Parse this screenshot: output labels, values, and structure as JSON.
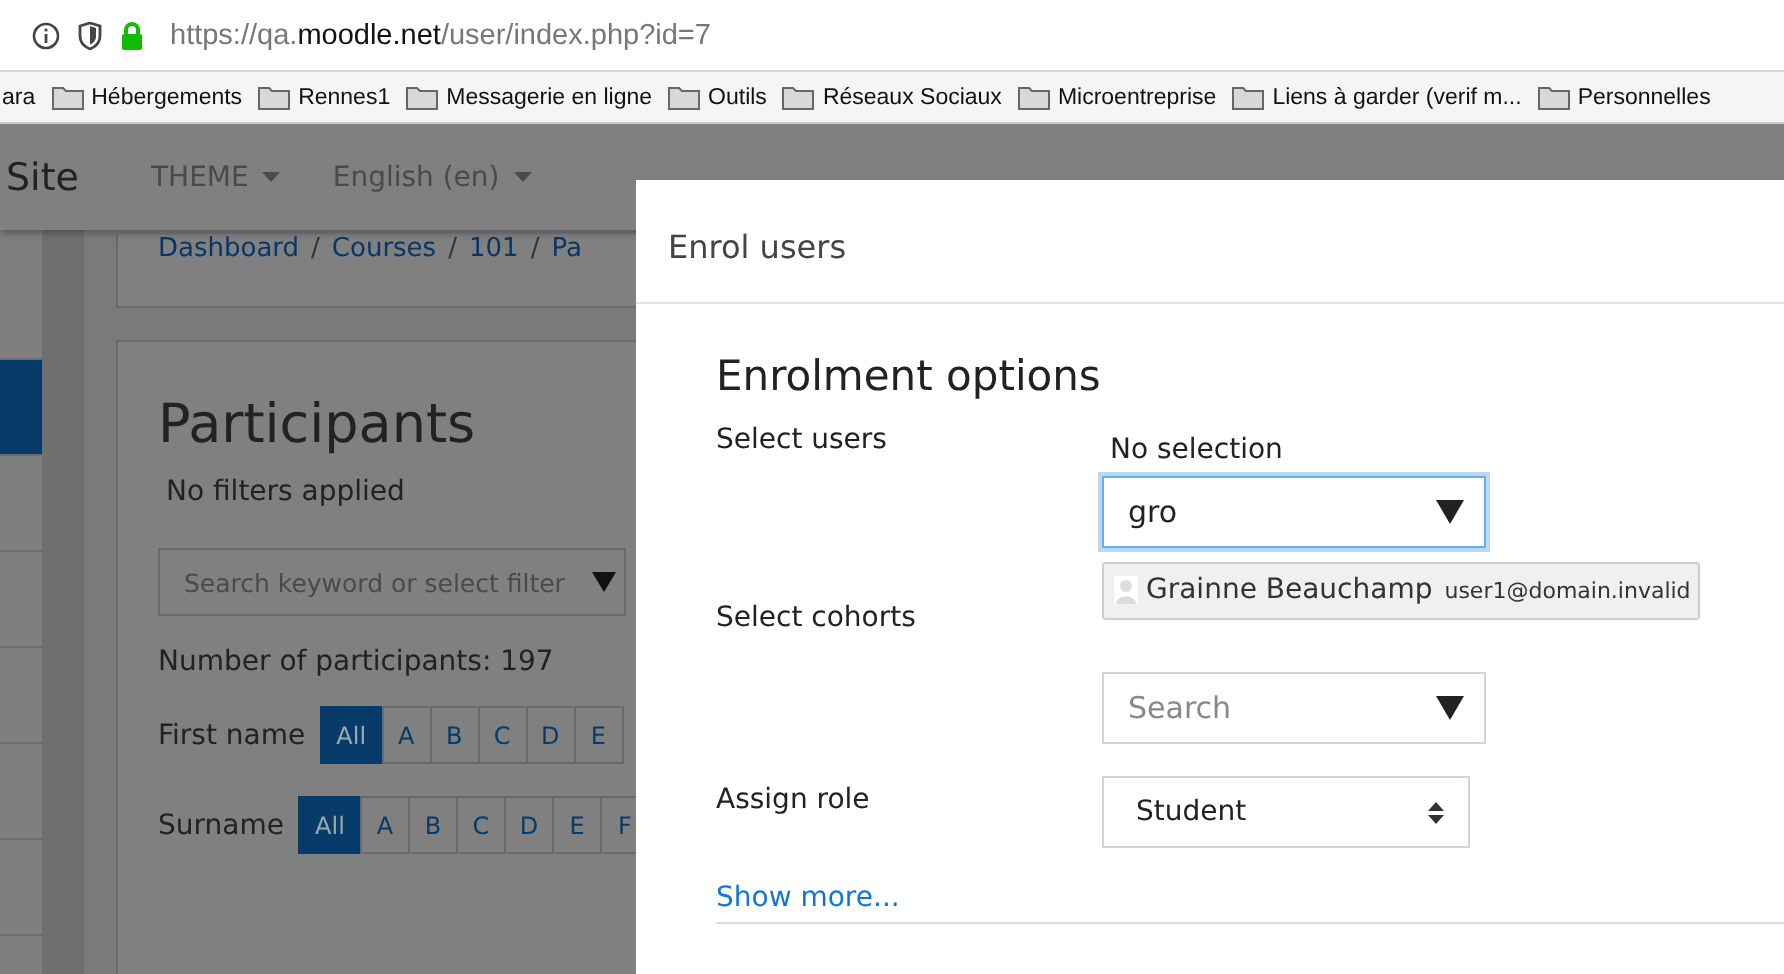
{
  "browser": {
    "url": "https://qa.**moodle.net**/user/index.php?id=7",
    "bookmarks": [
      {
        "label": "ara",
        "folder": false
      },
      {
        "label": "Hébergements",
        "folder": true
      },
      {
        "label": "Rennes1",
        "folder": true
      },
      {
        "label": "Messagerie en ligne",
        "folder": true
      },
      {
        "label": "Outils",
        "folder": true
      },
      {
        "label": "Réseaux Sociaux",
        "folder": true
      },
      {
        "label": "Microentreprise",
        "folder": true
      },
      {
        "label": "Liens à garder (verif m...",
        "folder": true
      },
      {
        "label": "Personnelles",
        "folder": true
      }
    ]
  },
  "navbar": {
    "site_name": "Site",
    "menus": [
      {
        "label": "THEME"
      },
      {
        "label": "English (en)"
      }
    ]
  },
  "sidebar": {
    "items": [
      {
        "selected": false
      },
      {
        "selected": true
      },
      {
        "selected": false
      },
      {
        "selected": false
      },
      {
        "selected": false
      },
      {
        "selected": false
      },
      {
        "selected": false
      }
    ]
  },
  "breadcrumb": {
    "separator": "/",
    "items": [
      "Dashboard",
      "Courses",
      "101",
      "Pa"
    ]
  },
  "participants": {
    "title": "Participants",
    "filter_status": "No filters applied",
    "search_placeholder": "Search keyword or select filter",
    "count": "Number of participants: 197",
    "initials": [
      {
        "label": "First name",
        "letters": [
          {
            "text": "All",
            "selected": true
          },
          {
            "text": "A",
            "selected": false
          },
          {
            "text": "B",
            "selected": false
          },
          {
            "text": "C",
            "selected": false
          },
          {
            "text": "D",
            "selected": false
          },
          {
            "text": "E",
            "selected": false
          }
        ]
      },
      {
        "label": "Surname",
        "letters": [
          {
            "text": "All",
            "selected": true
          },
          {
            "text": "A",
            "selected": false
          },
          {
            "text": "B",
            "selected": false
          },
          {
            "text": "C",
            "selected": false
          },
          {
            "text": "D",
            "selected": false
          },
          {
            "text": "E",
            "selected": false
          },
          {
            "text": "F",
            "selected": false
          }
        ]
      }
    ]
  },
  "modal": {
    "title": "Enrol users",
    "heading": "Enrolment options",
    "fields": [
      {
        "kind": "autocomplete",
        "label": "Select users",
        "selection": "No selection",
        "value": "gro",
        "focused": true,
        "suggestions": [
          {
            "name": "Grainne Beauchamp",
            "email": "user1@domain.invalid"
          }
        ]
      },
      {
        "kind": "autocomplete",
        "label": "Select cohorts",
        "placeholder": "Search",
        "focused": false
      },
      {
        "kind": "select",
        "label": "Assign role",
        "value": "Student"
      }
    ],
    "show_more": "Show more..."
  }
}
